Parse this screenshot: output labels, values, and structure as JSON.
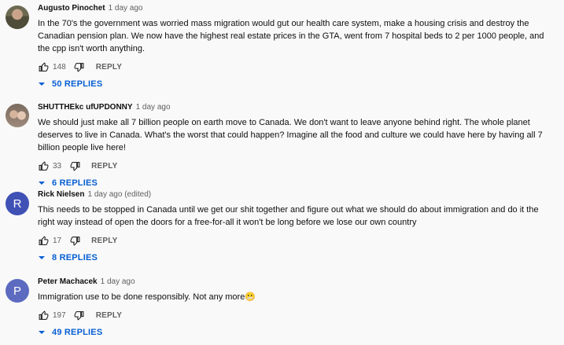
{
  "comments": [
    {
      "author": "Augusto Pinochet",
      "time": "1 day ago",
      "text": "In the 70's the government was worried  mass migration would gut our health care system, make a housing crisis and destroy the Canadian pension plan. We now have the highest real estate prices in the GTA, went from 7 hospital beds to 2 per 1000 people, and the cpp isn't worth anything.",
      "likes": "148",
      "reply_label": "REPLY",
      "replies_label": "50 REPLIES"
    },
    {
      "author": "SHUTTHEkc ufUPDONNY",
      "time": "1 day ago",
      "text": "We should just make all 7 billion people on earth move to Canada. We don't want to leave anyone behind right. The whole planet deserves to live in Canada. What's the worst that could happen? Imagine all the food and culture we could have here by having all 7 billion people live here!",
      "likes": "33",
      "reply_label": "REPLY",
      "replies_label": "6 REPLIES"
    },
    {
      "author": "Rick Nielsen",
      "time": "1 day ago (edited)",
      "avatar_letter": "R",
      "text": "This needs to be stopped in Canada until we get our shit together and figure out what we should do about immigration and do it the right way instead of open the doors for a free-for-all it won't be long before we lose our own country",
      "likes": "17",
      "reply_label": "REPLY",
      "replies_label": "8 REPLIES"
    },
    {
      "author": "Peter Machacek",
      "time": "1 day ago",
      "avatar_letter": "P",
      "text": "Immigration use to be done responsibly. Not any more😬",
      "likes": "197",
      "reply_label": "REPLY",
      "replies_label": "49 REPLIES"
    }
  ],
  "colors": {
    "link_blue": "#065fd4",
    "meta_gray": "#606060",
    "avatar_r": "#3f51b5",
    "avatar_p": "#5c6bc0"
  },
  "icons": [
    "thumbs-up-icon",
    "thumbs-down-icon",
    "chevron-down-icon"
  ]
}
